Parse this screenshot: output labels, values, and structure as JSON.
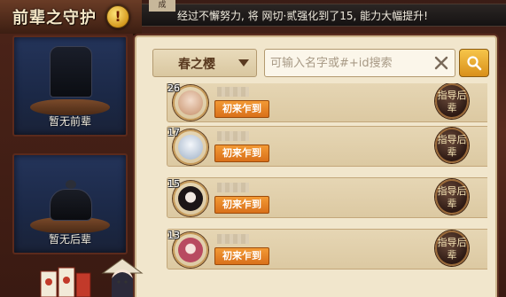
{
  "header": {
    "title": "前辈之守护",
    "alert_symbol": "!",
    "notice_tag": "成",
    "notice_text": "经过不懈努力, 将 网切·贰强化到了15, 能力大幅提升!"
  },
  "left_panel": {
    "senior_slot_caption": "暂无前辈",
    "junior_slot_caption": "暂无后辈"
  },
  "toolbar": {
    "server_select": "春之樱",
    "search_placeholder": "可输入名字或#+id搜索"
  },
  "players": [
    {
      "level": "26",
      "badge": "初来乍到",
      "guide_label": "指导后辈",
      "avatar_color": "#e7c3b0"
    },
    {
      "level": "17",
      "badge": "初来乍到",
      "guide_label": "指导后辈",
      "avatar_color": "#dfe6ee"
    },
    {
      "level": "15",
      "badge": "初来乍到",
      "guide_label": "指导后辈",
      "avatar_color": "#2a2224"
    },
    {
      "level": "13",
      "badge": "初来乍到",
      "guide_label": "指导后辈",
      "avatar_color": "#d79aa6"
    }
  ],
  "colors": {
    "panel_bg": "#f1e6cc",
    "badge_orange": "#e8821f",
    "frame_red": "#5a2c1f",
    "search_gold": "#f2b635"
  },
  "icons": {
    "clear": "close-icon",
    "search": "search-icon",
    "dropdown": "caret-down-icon"
  }
}
